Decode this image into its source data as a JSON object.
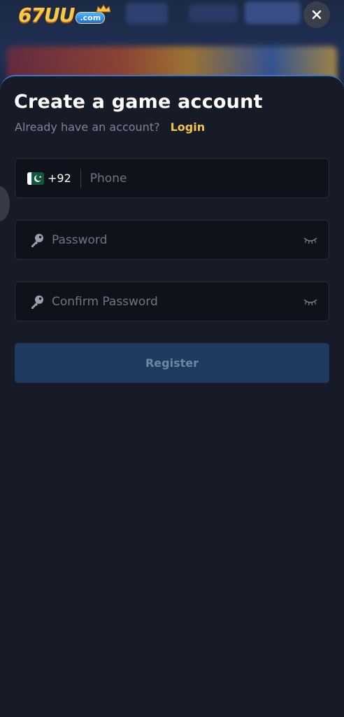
{
  "header": {
    "logo_text": "67UU",
    "logo_badge": ".com",
    "close_icon": "close-icon"
  },
  "form": {
    "title": "Create a game account",
    "subtitle": "Already have an account?",
    "login_label": "Login",
    "country_code": "+92",
    "flag": "pakistan-flag-icon",
    "phone_placeholder": "Phone",
    "password_placeholder": "Password",
    "confirm_password_placeholder": "Confirm Password",
    "key_icon": "key-icon",
    "eye_icon": "eye-closed-icon",
    "register_label": "Register"
  },
  "colors": {
    "background": "#161b27",
    "field": "#0e121b",
    "accent_login": "#f5c542",
    "register_bg": "#1f3a5e",
    "register_text": "#6c86a6",
    "sheet_border": "#3b76c8"
  }
}
